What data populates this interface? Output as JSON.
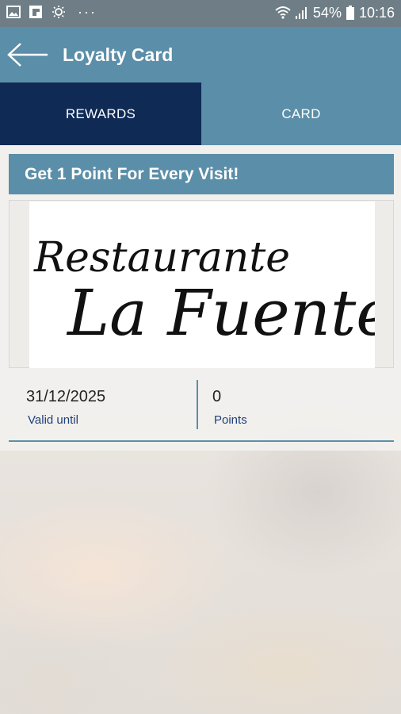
{
  "status_bar": {
    "battery": "54%",
    "time": "10:16",
    "more": "···",
    "icons": [
      "gallery-icon",
      "flipboard-icon",
      "brightness-icon",
      "wifi-icon",
      "signal-icon",
      "battery-icon"
    ]
  },
  "app_bar": {
    "title": "Loyalty Card",
    "back_icon": "arrow-left-icon"
  },
  "tabs": [
    {
      "label": "REWARDS",
      "active": true
    },
    {
      "label": "CARD",
      "active": false
    }
  ],
  "banner": {
    "text": "Get 1 Point For Every Visit!"
  },
  "logo": {
    "line1": "Restaurante",
    "line2": "La Fuente"
  },
  "info": {
    "valid_date": "31/12/2025",
    "valid_label": "Valid until",
    "points_value": "0",
    "points_label": "Points"
  },
  "colors": {
    "status_bar": "#6f7e86",
    "app_bar": "#5b8ea8",
    "tab_active": "#0e2a55",
    "accent": "#5b8ea8",
    "label_text": "#1e3f7a"
  }
}
